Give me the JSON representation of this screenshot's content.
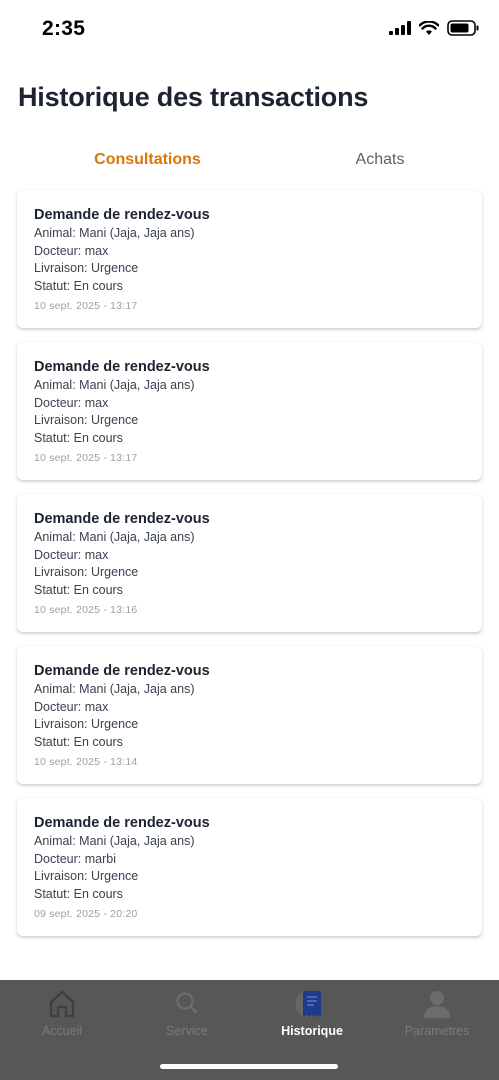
{
  "status_bar": {
    "time": "2:35"
  },
  "header": {
    "title": "Historique des transactions"
  },
  "tabs": [
    {
      "label": "Consultations",
      "active": true
    },
    {
      "label": "Achats",
      "active": false
    }
  ],
  "transactions": [
    {
      "title": "Demande de rendez-vous",
      "animal": "Animal: Mani (Jaja, Jaja ans)",
      "doctor": "Docteur: max",
      "delivery": "Livraison: Urgence",
      "status": "Statut: En cours",
      "date": "10 sept. 2025 - 13:17"
    },
    {
      "title": "Demande de rendez-vous",
      "animal": "Animal: Mani (Jaja, Jaja ans)",
      "doctor": "Docteur: max",
      "delivery": "Livraison: Urgence",
      "status": "Statut: En cours",
      "date": "10 sept. 2025 - 13:17"
    },
    {
      "title": "Demande de rendez-vous",
      "animal": "Animal: Mani (Jaja, Jaja ans)",
      "doctor": "Docteur: max",
      "delivery": "Livraison: Urgence",
      "status": "Statut: En cours",
      "date": "10 sept. 2025 - 13:16"
    },
    {
      "title": "Demande de rendez-vous",
      "animal": "Animal: Mani (Jaja, Jaja ans)",
      "doctor": "Docteur: max",
      "delivery": "Livraison: Urgence",
      "status": "Statut: En cours",
      "date": "10 sept. 2025 - 13:14"
    },
    {
      "title": "Demande de rendez-vous",
      "animal": "Animal: Mani (Jaja, Jaja ans)",
      "doctor": "Docteur: marbi",
      "delivery": "Livraison: Urgence",
      "status": "Statut: En cours",
      "date": "09 sept. 2025 - 20:20"
    }
  ],
  "bottom_nav": {
    "items": [
      {
        "label": "Accueil",
        "icon": "home-icon",
        "active": false
      },
      {
        "label": "Service",
        "icon": "search-icon",
        "active": false
      },
      {
        "label": "Historique",
        "icon": "receipt-icon",
        "active": true
      },
      {
        "label": "Parametres",
        "icon": "person-icon",
        "active": false
      }
    ]
  },
  "colors": {
    "accent": "#d97706",
    "active_nav_icon": "#1e3a8a",
    "nav_background": "#575757",
    "title": "#1b2430"
  }
}
